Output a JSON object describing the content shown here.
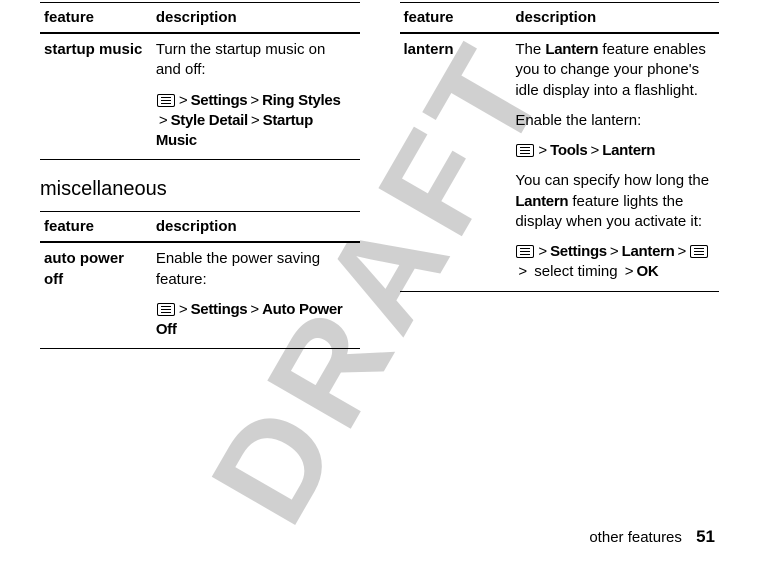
{
  "watermark": "DRAFT",
  "left": {
    "table1": {
      "header_feature": "feature",
      "header_description": "description",
      "row1": {
        "feature": "startup music",
        "desc_text": "Turn the startup music on and off:",
        "path_p1": "Settings",
        "path_p2": "Ring Styles",
        "path_p3": "Style Detail",
        "path_p4": "Startup Music"
      }
    },
    "section_title": "miscellaneous",
    "table2": {
      "header_feature": "feature",
      "header_description": "description",
      "row1": {
        "feature": "auto power off",
        "desc_text": "Enable the power saving feature:",
        "path_p1": "Settings",
        "path_p2": "Auto Power Off"
      }
    }
  },
  "right": {
    "table1": {
      "header_feature": "feature",
      "header_description": "description",
      "row1": {
        "feature": "lantern",
        "desc_para1_pre": "The ",
        "desc_para1_bold": "Lantern",
        "desc_para1_post": " feature enables you to change your phone's idle display into a flashlight.",
        "desc_para2": "Enable the lantern:",
        "path1_p1": "Tools",
        "path1_p2": "Lantern",
        "desc_para3_pre": "You can specify how long the ",
        "desc_para3_bold": "Lantern",
        "desc_para3_post": " feature lights the display when you activate it:",
        "path2_p1": "Settings",
        "path2_p2": "Lantern",
        "path2_sel": " select timing ",
        "path2_ok": "OK"
      }
    }
  },
  "footer": {
    "text": "other features",
    "page": "51"
  }
}
